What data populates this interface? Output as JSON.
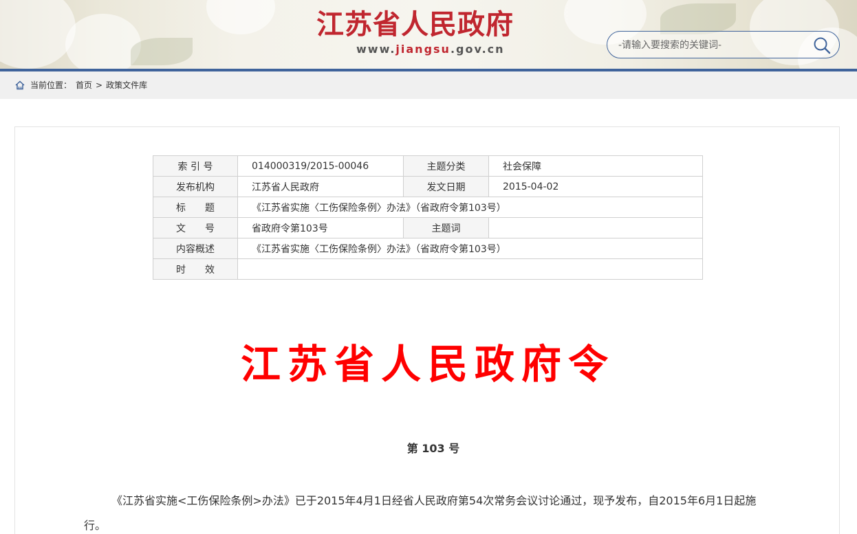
{
  "header": {
    "title": "江苏省人民政府",
    "url_prefix": "www.",
    "url_highlight": "jiangsu",
    "url_suffix": ".gov.cn",
    "search_placeholder": "-请输入要搜索的关键词-"
  },
  "breadcrumb": {
    "label": "当前位置：",
    "items": [
      "首页",
      "政策文件库"
    ],
    "separator": ">"
  },
  "meta": {
    "index_label": "索 引 号",
    "index_value": "014000319/2015-00046",
    "category_label": "主题分类",
    "category_value": "社会保障",
    "publisher_label": "发布机构",
    "publisher_value": "江苏省人民政府",
    "date_label": "发文日期",
    "date_value": "2015-04-02",
    "title_label": "标　　题",
    "title_value": "《江苏省实施〈工伤保险条例〉办法》（省政府令第103号）",
    "docno_label": "文　　号",
    "docno_value": "省政府令第103号",
    "keyword_label": "主题词",
    "keyword_value": "",
    "summary_label": "内容概述",
    "summary_value": "《江苏省实施〈工伤保险条例〉办法》（省政府令第103号）",
    "validity_label": "时　　效",
    "validity_value": ""
  },
  "document": {
    "heading": "江苏省人民政府令",
    "number": "第 103 号",
    "body": "《江苏省实施<工伤保险条例>办法》已于2015年4月1日经省人民政府第54次常务会议讨论通过，现予发布，自2015年6月1日起施行。"
  },
  "colors": {
    "brand_red": "#c0262f",
    "heading_red": "#ff0000",
    "accent_blue": "#3f639b"
  },
  "icons": [
    "home-icon",
    "search-icon"
  ]
}
